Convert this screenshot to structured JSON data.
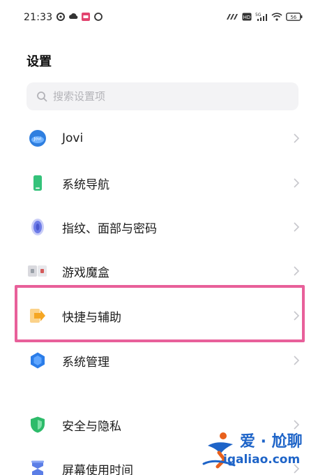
{
  "status_bar": {
    "time": "21:33",
    "left_icons": [
      "notification-icon",
      "cloud-icon",
      "app-badge-icon",
      "circle-icon"
    ],
    "right_icons": [
      "carrier-icon",
      "hd-icon",
      "signal-5g-icon",
      "wifi-icon",
      "battery-icon"
    ],
    "battery_label": "56"
  },
  "header": {
    "title": "设置"
  },
  "search": {
    "placeholder": "搜索设置项",
    "value": ""
  },
  "settings_items": [
    {
      "label": "Jovi",
      "icon": "jovi-icon",
      "icon_color": "#2f7fe0"
    },
    {
      "label": "系统导航",
      "icon": "navigation-icon",
      "icon_color": "#34c27a"
    },
    {
      "label": "指纹、面部与密码",
      "icon": "fingerprint-icon",
      "icon_color": "#6f7de8"
    },
    {
      "label": "游戏魔盒",
      "icon": "game-box-icon",
      "icon_color": "#d45a5a"
    },
    {
      "label": "快捷与辅助",
      "icon": "shortcut-icon",
      "icon_color": "#f5a623"
    },
    {
      "label": "系统管理",
      "icon": "system-management-icon",
      "icon_color": "#2b7de9"
    },
    {
      "label": "安全与隐私",
      "icon": "security-shield-icon",
      "icon_color": "#2dbb6a"
    },
    {
      "label": "屏幕使用时间",
      "icon": "screen-time-icon",
      "icon_color": "#5b7ee6"
    }
  ],
  "highlight": {
    "target_label": "快捷与辅助",
    "color": "#e8609a"
  },
  "watermark": {
    "title": "爱 · 尬聊",
    "domain": "igaliao.com",
    "color": "#1e64c8"
  }
}
